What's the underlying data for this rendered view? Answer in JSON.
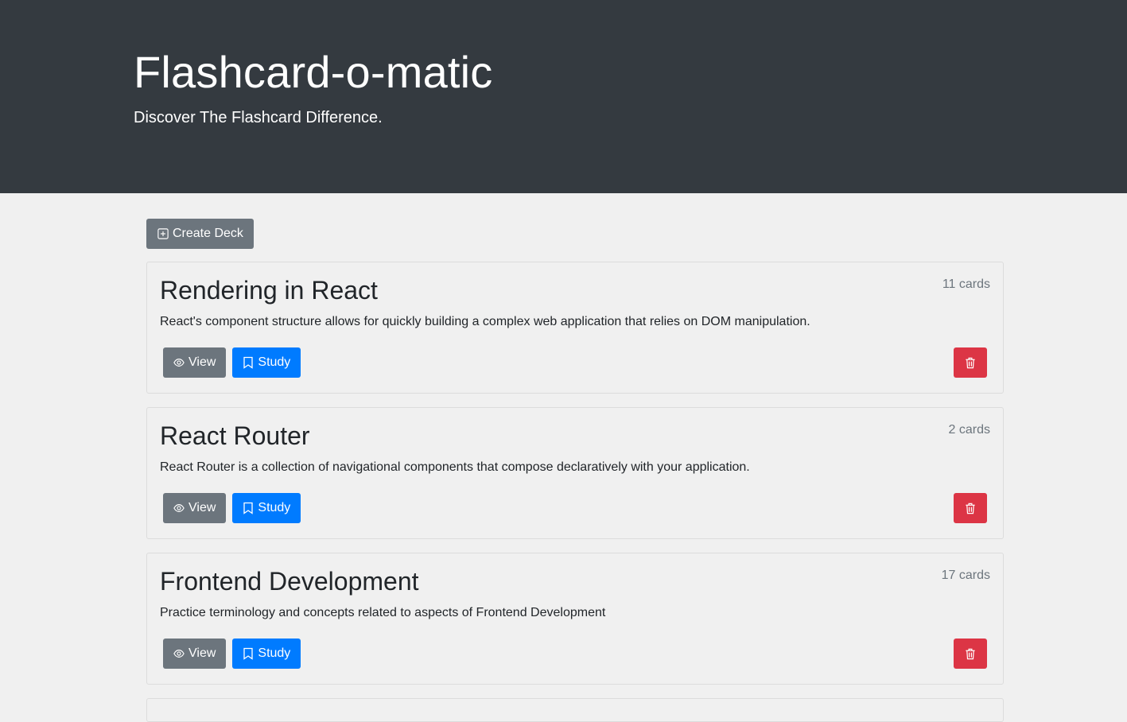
{
  "header": {
    "title": "Flashcard-o-matic",
    "subtitle": "Discover The Flashcard Difference."
  },
  "toolbar": {
    "create_label": "Create Deck",
    "create_icon": "plus-square-icon"
  },
  "decks": [
    {
      "name": "Rendering in React",
      "count": "11 cards",
      "description": "React's component structure allows for quickly building a complex web application that relies on DOM manipulation.",
      "view_label": "View",
      "study_label": "Study"
    },
    {
      "name": "React Router",
      "count": "2 cards",
      "description": "React Router is a collection of navigational components that compose declaratively with your application.",
      "view_label": "View",
      "study_label": "Study"
    },
    {
      "name": "Frontend Development",
      "count": "17 cards",
      "description": "Practice terminology and concepts related to aspects of Frontend Development",
      "view_label": "View",
      "study_label": "Study"
    }
  ],
  "colors": {
    "header_bg": "#343a40",
    "page_bg": "#f0f0f0",
    "secondary": "#6c757d",
    "primary": "#007bff",
    "danger": "#dc3545"
  }
}
